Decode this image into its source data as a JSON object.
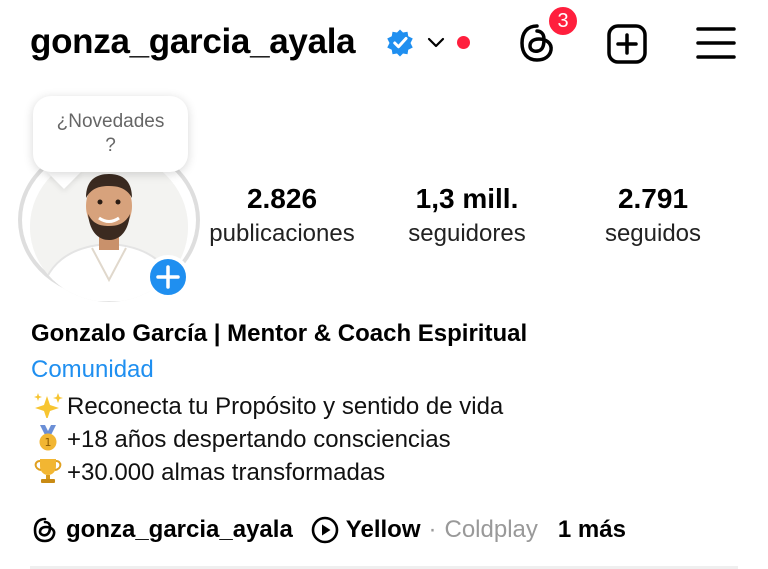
{
  "header": {
    "username": "gonza_garcia_ayala",
    "threads_badge_count": "3",
    "icons": [
      "verified-icon",
      "chevron-down-icon",
      "threads-icon",
      "add-post-icon",
      "menu-icon"
    ]
  },
  "story_bubble": {
    "text_line1": "¿Novedades",
    "text_line2": "?"
  },
  "stats": {
    "posts": {
      "value": "2.826",
      "label": "publicaciones"
    },
    "followers": {
      "value": "1,3 mill.",
      "label": "seguidores"
    },
    "following": {
      "value": "2.791",
      "label": "seguidos"
    }
  },
  "profile": {
    "name": "Gonzalo García | Mentor & Coach Espiritual",
    "category": "Comunidad",
    "bio": [
      {
        "emoji": "sparkles-icon",
        "text": "Reconecta tu Propósito y sentido de vida"
      },
      {
        "emoji": "medal-icon",
        "text": "+18 años despertando consciencias"
      },
      {
        "emoji": "trophy-icon",
        "text": "+30.000 almas transformadas"
      }
    ]
  },
  "links": {
    "threads_handle": "gonza_garcia_ayala",
    "song_title": "Yellow",
    "separator": "·",
    "song_artist": "Coldplay",
    "more": "1 más"
  },
  "colors": {
    "accent_blue": "#1f8ff0",
    "notification_red": "#ff1f3d",
    "ring_gray": "#dedede"
  }
}
